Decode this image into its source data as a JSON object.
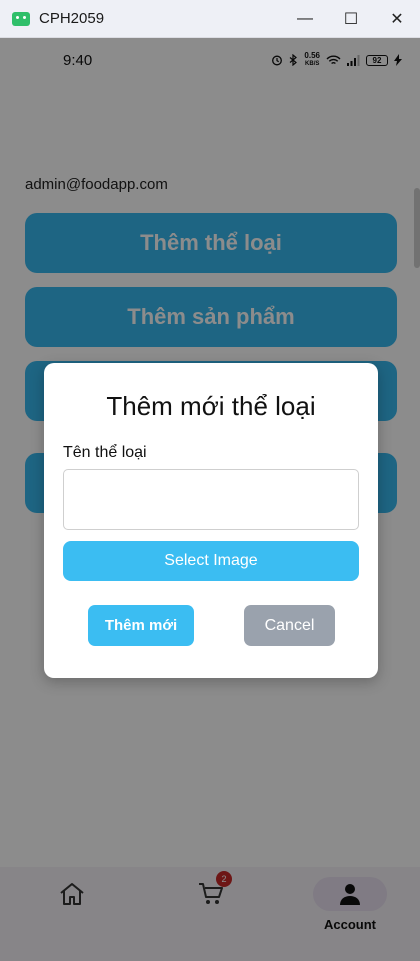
{
  "window": {
    "title": "CPH2059",
    "minimize": "—",
    "maximize": "☐",
    "close": "✕"
  },
  "status_bar": {
    "time": "9:40",
    "net_speed_value": "0.56",
    "net_speed_unit": "KB/S",
    "battery": "92"
  },
  "main": {
    "email": "admin@foodapp.com",
    "buttons": [
      {
        "label": "Thêm thể loại"
      },
      {
        "label": "Thêm sản phẩm"
      },
      {
        "label": ""
      },
      {
        "label": ""
      }
    ]
  },
  "bottom_nav": {
    "home_icon": "home-icon",
    "cart_icon": "cart-icon",
    "cart_badge": "2",
    "account_icon": "person-icon",
    "account_label": "Account"
  },
  "dialog": {
    "title": "Thêm mới thể loại",
    "field_label": "Tên thể loại",
    "field_value": "",
    "select_image": "Select Image",
    "add_label": "Thêm mới",
    "cancel_label": "Cancel"
  },
  "colors": {
    "accent": "#3bbdf2",
    "cancel": "#9aa2ad",
    "badge": "#c62828"
  }
}
